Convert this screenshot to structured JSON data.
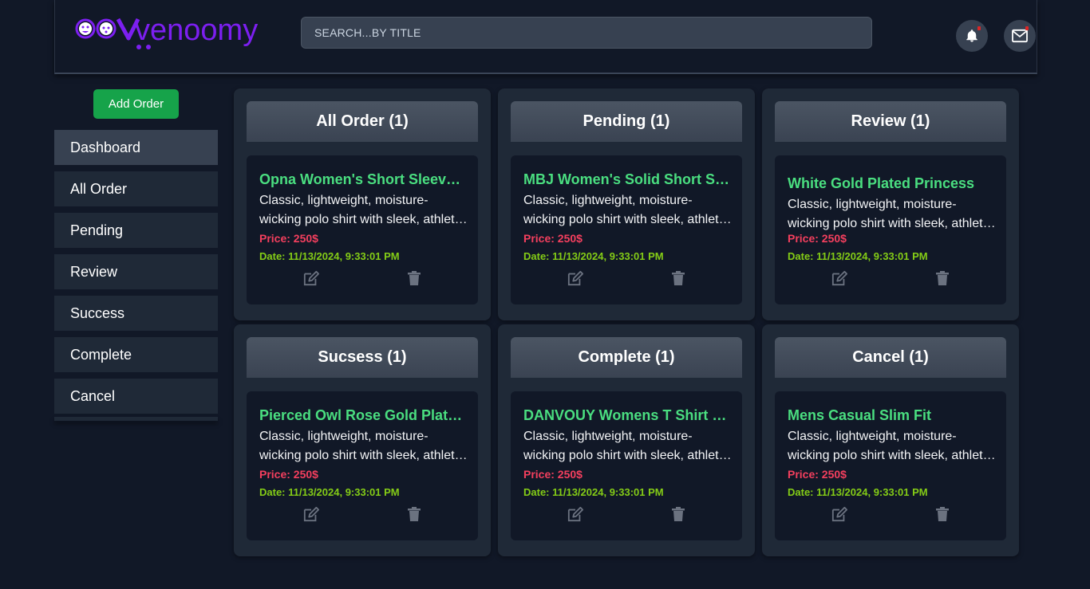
{
  "header": {
    "logo_text": "venoomy",
    "search": {
      "placeholder": "SEARCH...BY TITLE",
      "value": ""
    },
    "icons": [
      "bell-icon",
      "mail-icon"
    ]
  },
  "sidebar": {
    "add_button": "Add Order",
    "items": [
      {
        "label": "Dashboard",
        "active": true
      },
      {
        "label": "All Order"
      },
      {
        "label": "Pending"
      },
      {
        "label": "Review"
      },
      {
        "label": "Success"
      },
      {
        "label": "Complete"
      },
      {
        "label": "Cancel"
      }
    ]
  },
  "colors": {
    "background": "#111827",
    "panel": "#1f2937",
    "accent_green": "#16a34a",
    "title_green": "#4ade80",
    "price_red": "#f43f5e",
    "date_lime": "#84cc16",
    "logo_purple": "#7c1ff0"
  },
  "panels": [
    {
      "title": "All Order (1)",
      "card": {
        "title": "Opna Women's Short Sleeve Moisture",
        "desc": "Classic, lightweight, moisture-wicking polo shirt with sleek, athletic fit",
        "price": "Price: 250$",
        "date": "Date: 11/13/2024, 9:33:01 PM"
      }
    },
    {
      "title": "Pending (1)",
      "card": {
        "title": "MBJ Women's Solid Short Sleeve Boat Neck V",
        "desc": "Classic, lightweight, moisture-wicking polo shirt with sleek, athletic fit",
        "price": "Price: 250$",
        "date": "Date: 11/13/2024, 9:33:01 PM"
      }
    },
    {
      "title": "Review (1)",
      "card": {
        "title": "White Gold Plated Princess",
        "desc": "Classic, lightweight, moisture-wicking polo shirt with sleek, athletic fit",
        "price": "Price: 250$",
        "date": "Date: 11/13/2024, 9:33:01 PM"
      }
    },
    {
      "title": "Sucsess (1)",
      "card": {
        "title": "Pierced Owl Rose Gold Plated Stainless Steel Double",
        "desc": "Classic, lightweight, moisture-wicking polo shirt with sleek, athletic fit",
        "price": "Price: 250$",
        "date": "Date: 11/13/2024, 9:33:01 PM"
      }
    },
    {
      "title": "Complete (1)",
      "card": {
        "title": "DANVOUY Womens T Shirt Casual Cotton Short",
        "desc": "Classic, lightweight, moisture-wicking polo shirt with sleek, athletic fit",
        "price": "Price: 250$",
        "date": "Date: 11/13/2024, 9:33:01 PM"
      }
    },
    {
      "title": "Cancel (1)",
      "card": {
        "title": "Mens Casual Slim Fit",
        "desc": "Classic, lightweight, moisture-wicking polo shirt with sleek, athletic fit",
        "price": "Price: 250$",
        "date": "Date: 11/13/2024, 9:33:01 PM"
      }
    }
  ]
}
